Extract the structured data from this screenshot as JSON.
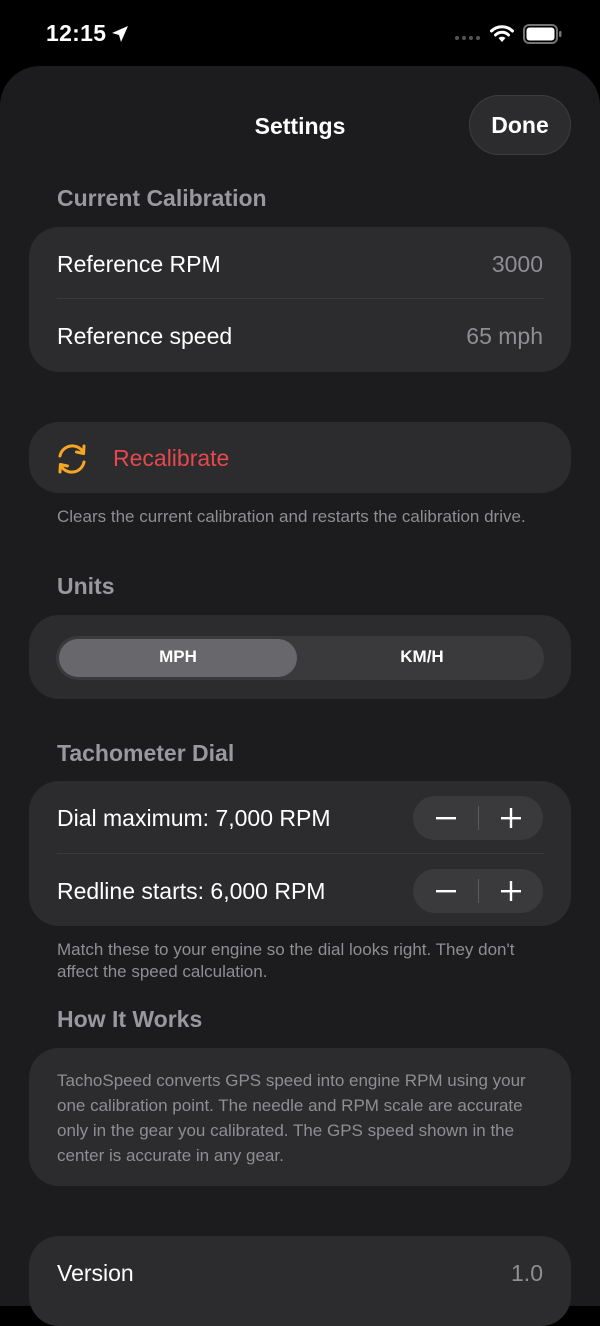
{
  "status_bar": {
    "time": "12:15",
    "icons": [
      "location-arrow-icon",
      "cellular-dots-icon",
      "wifi-icon",
      "battery-icon"
    ]
  },
  "header": {
    "title": "Settings",
    "done_label": "Done"
  },
  "calibration": {
    "header": "Current Calibration",
    "rows": [
      {
        "label": "Reference RPM",
        "value": "3000"
      },
      {
        "label": "Reference speed",
        "value": "65 mph"
      }
    ]
  },
  "recalibrate": {
    "label": "Recalibrate",
    "icon": "refresh-arrows-icon",
    "footnote": "Clears the current calibration and restarts the calibration drive."
  },
  "units": {
    "header": "Units",
    "options": [
      "MPH",
      "KM/H"
    ],
    "selected": "MPH"
  },
  "tachometer": {
    "header": "Tachometer Dial",
    "dial_max_label": "Dial maximum: 7,000 RPM",
    "redline_label": "Redline starts: 6,000 RPM",
    "footnote": "Match these to your engine so the dial looks right. They don't affect the speed calculation."
  },
  "how_it_works": {
    "header": "How It Works",
    "text": "TachoSpeed converts GPS speed into engine RPM using your one calibration point. The needle and RPM scale are accurate only in the gear you calibrated. The GPS speed shown in the center is accurate in any gear."
  },
  "about": {
    "version_label": "Version",
    "version_value": "1.0"
  },
  "colors": {
    "accent_red": "#e5484d",
    "icon_orange": "#f5a623",
    "background": "#1c1c1e",
    "card": "#2c2c2e"
  }
}
